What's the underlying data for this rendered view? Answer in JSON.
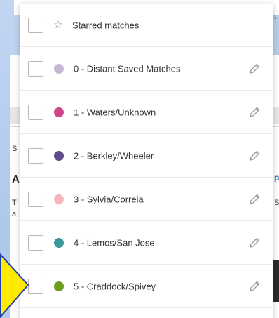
{
  "background": {
    "fragments": {
      "left_s": "S",
      "left_heading": "A",
      "left_t": "T",
      "left_a": "a",
      "right_top": "t",
      "right_link": "p",
      "right_s": "S"
    }
  },
  "dropdown": {
    "starred": {
      "label": "Starred matches",
      "icon": "star-icon"
    },
    "groups": [
      {
        "label": "0 - Distant Saved Matches",
        "color": "#c5b9d8"
      },
      {
        "label": "1 - Waters/Unknown",
        "color": "#d3458b"
      },
      {
        "label": "2 - Berkley/Wheeler",
        "color": "#5e4f8a"
      },
      {
        "label": "3 - Sylvia/Correia",
        "color": "#f7b6bf"
      },
      {
        "label": "4 - Lemos/San Jose",
        "color": "#3a9a9a"
      },
      {
        "label": "5 - Craddock/Spivey",
        "color": "#6a9e21"
      }
    ]
  },
  "colors": {
    "pointer": "#ffea00",
    "pointer_border": "#1f3fb0"
  }
}
